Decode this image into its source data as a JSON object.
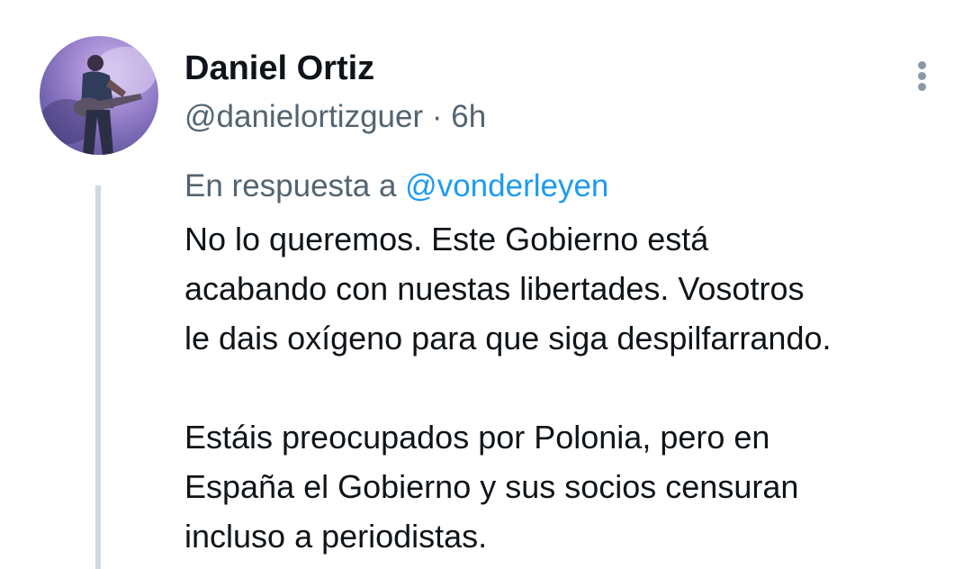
{
  "author": {
    "name": "Daniel Ortiz",
    "handle": "@danielortizguer",
    "separator": "·",
    "time": "6h"
  },
  "more_icon": "vertical-ellipsis-icon",
  "reply": {
    "prefix": "En respuesta a",
    "mention": "@vonderleyen"
  },
  "body": {
    "paragraph1": [
      "No lo queremos. Este Gobierno está",
      "acabando con nuestas libertades. Vosotros",
      "le dais oxígeno para que siga despilfarrando."
    ],
    "paragraph2": [
      "Estáis preocupados por Polonia, pero en",
      "España el Gobierno y sus socios censuran",
      "incluso a periodistas."
    ]
  },
  "colors": {
    "name": "#0f1419",
    "secondary_text": "#536471",
    "link": "#1d9bf0",
    "thread_line": "#cfd9de"
  }
}
